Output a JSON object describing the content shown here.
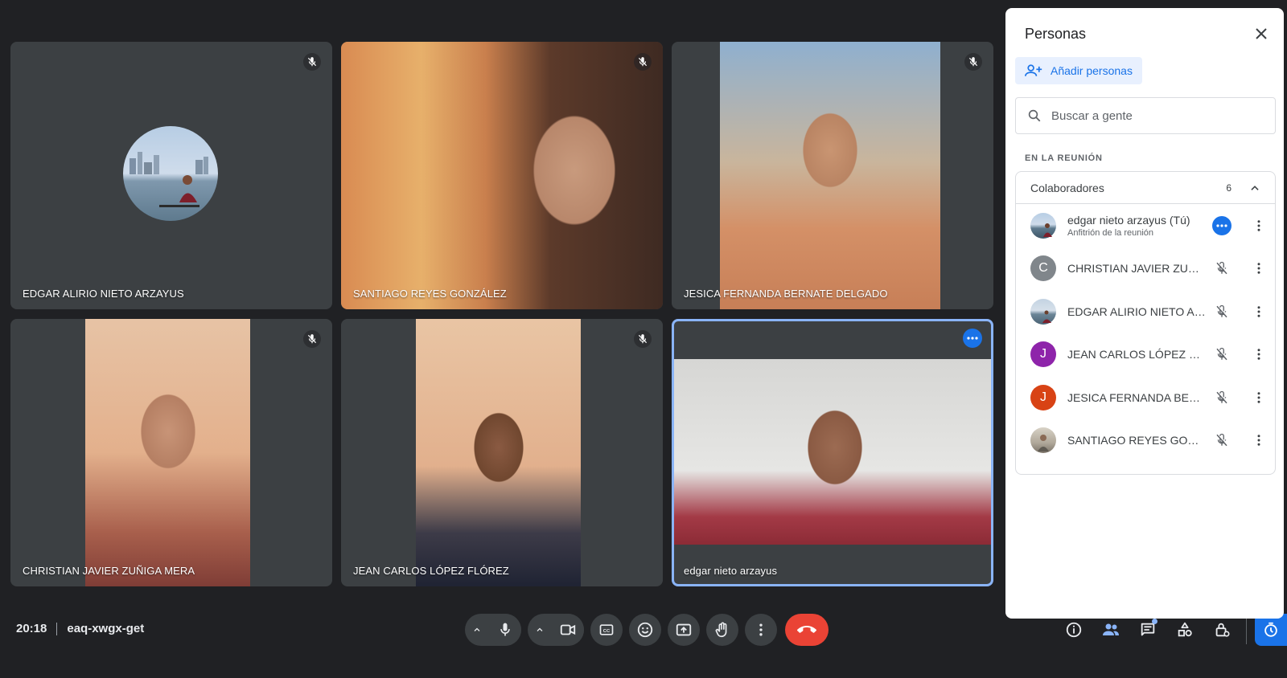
{
  "tiles": [
    {
      "name": "EDGAR ALIRIO NIETO ARZAYUS",
      "muted": true
    },
    {
      "name": "SANTIAGO REYES GONZÁLEZ",
      "muted": true
    },
    {
      "name": "JESICA FERNANDA BERNATE DELGADO",
      "muted": true
    },
    {
      "name": "CHRISTIAN JAVIER ZUÑIGA MERA",
      "muted": true
    },
    {
      "name": "JEAN CARLOS LÓPEZ FLÓREZ",
      "muted": true
    },
    {
      "name": "edgar nieto arzayus",
      "muted": false,
      "active": true
    }
  ],
  "meeting": {
    "time": "20:18",
    "code": "eaq-xwgx-get"
  },
  "toolbar": {
    "icons": [
      "chevron-up-icon",
      "mic-icon",
      "chevron-up-icon",
      "camera-icon",
      "captions-icon",
      "emoji-icon",
      "present-icon",
      "raise-hand-icon",
      "more-vert-icon",
      "hang-up-icon"
    ],
    "right_icons": [
      "info-icon",
      "people-icon",
      "chat-icon",
      "activities-icon",
      "host-controls-icon",
      "timer-icon"
    ],
    "people_count": "6"
  },
  "panel": {
    "title": "Personas",
    "add_label": "Añadir personas",
    "search_placeholder": "Buscar a gente",
    "section_label": "EN LA REUNIÓN",
    "group": {
      "name": "Colaboradores",
      "count": "6"
    },
    "people": [
      {
        "name": "edgar nieto arzayus (Tú)",
        "sub": "Anfitrión de la reunión",
        "initial": "",
        "color": "#8aa6c1",
        "status": "more-options"
      },
      {
        "name": "CHRISTIAN JAVIER ZUÑI...",
        "sub": "",
        "initial": "C",
        "color": "#80868b",
        "status": "muted"
      },
      {
        "name": "EDGAR ALIRIO NIETO AR...",
        "sub": "",
        "initial": "",
        "color": "#a9b9c6",
        "status": "muted"
      },
      {
        "name": "JEAN CARLOS LÓPEZ FL...",
        "sub": "",
        "initial": "J",
        "color": "#8e24aa",
        "status": "muted"
      },
      {
        "name": "JESICA FERNANDA BERN...",
        "sub": "",
        "initial": "J",
        "color": "#d84315",
        "status": "muted"
      },
      {
        "name": "SANTIAGO REYES GONZ...",
        "sub": "",
        "initial": "",
        "color": "#b0a89a",
        "status": "muted"
      }
    ]
  },
  "colors": {
    "accent": "#1a73e8",
    "hangup": "#ea4335",
    "background": "#202124",
    "tile": "#3c4043"
  }
}
